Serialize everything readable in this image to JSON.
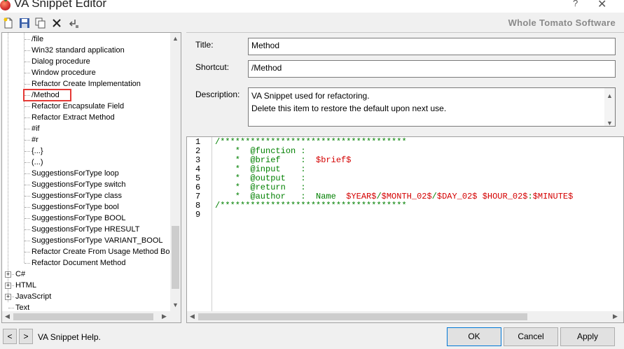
{
  "window": {
    "title": "VA Snippet Editor",
    "help_glyph": "?",
    "close_glyph": "✕"
  },
  "toolbar": {
    "brand": "Whole Tomato Software"
  },
  "tree": {
    "items": [
      {
        "label": "/file",
        "level": 2
      },
      {
        "label": "Win32 standard application",
        "level": 2
      },
      {
        "label": "Dialog procedure",
        "level": 2
      },
      {
        "label": "Window procedure",
        "level": 2
      },
      {
        "label": "Refactor Create Implementation",
        "level": 2
      },
      {
        "label": "/Method",
        "level": 2,
        "selected": true
      },
      {
        "label": "Refactor Encapsulate Field",
        "level": 2
      },
      {
        "label": "Refactor Extract Method",
        "level": 2
      },
      {
        "label": "#if",
        "level": 2
      },
      {
        "label": "#r",
        "level": 2
      },
      {
        "label": "{...}",
        "level": 2
      },
      {
        "label": "(...)",
        "level": 2
      },
      {
        "label": "SuggestionsForType loop",
        "level": 2
      },
      {
        "label": "SuggestionsForType switch",
        "level": 2
      },
      {
        "label": "SuggestionsForType class",
        "level": 2
      },
      {
        "label": "SuggestionsForType bool",
        "level": 2
      },
      {
        "label": "SuggestionsForType BOOL",
        "level": 2
      },
      {
        "label": "SuggestionsForType HRESULT",
        "level": 2
      },
      {
        "label": "SuggestionsForType VARIANT_BOOL",
        "level": 2
      },
      {
        "label": "Refactor Create From Usage Method Bod",
        "level": 2
      },
      {
        "label": "Refactor Document Method",
        "level": 2
      },
      {
        "label": "C#",
        "level": 1,
        "expander": "+"
      },
      {
        "label": "HTML",
        "level": 1,
        "expander": "+"
      },
      {
        "label": "JavaScript",
        "level": 1,
        "expander": "+"
      },
      {
        "label": "Text",
        "level": 1
      }
    ]
  },
  "form": {
    "title_label": "Title:",
    "title_value": "Method",
    "shortcut_label": "Shortcut:",
    "shortcut_value": "/Method",
    "description_label": "Description:",
    "description_line1": "VA Snippet used for refactoring.",
    "description_line2": "Delete this item to restore the default upon next use."
  },
  "editor": {
    "line_numbers": [
      "1",
      "2",
      "3",
      "4",
      "5",
      "6",
      "7",
      "8",
      "9"
    ],
    "lines": [
      [
        {
          "t": "/*************************************",
          "c": "green"
        }
      ],
      [
        {
          "t": "    *  @function :",
          "c": "green"
        }
      ],
      [
        {
          "t": "    *  @brief    :  ",
          "c": "green"
        },
        {
          "t": "$brief$",
          "c": "red"
        }
      ],
      [
        {
          "t": "    *  @input    :",
          "c": "green"
        }
      ],
      [
        {
          "t": "    *  @output   :",
          "c": "green"
        }
      ],
      [
        {
          "t": "    *  @return   :",
          "c": "green"
        }
      ],
      [
        {
          "t": "    *  @author   :  Name  ",
          "c": "green"
        },
        {
          "t": "$YEAR$",
          "c": "red"
        },
        {
          "t": "/",
          "c": "green"
        },
        {
          "t": "$MONTH_02$",
          "c": "red"
        },
        {
          "t": "/",
          "c": "green"
        },
        {
          "t": "$DAY_02$",
          "c": "red"
        },
        {
          "t": " ",
          "c": "green"
        },
        {
          "t": "$HOUR_02$",
          "c": "red"
        },
        {
          "t": ":",
          "c": "green"
        },
        {
          "t": "$MINUTE$",
          "c": "red"
        }
      ],
      [
        {
          "t": "/*************************************",
          "c": "green"
        }
      ],
      []
    ]
  },
  "bottom": {
    "prev_label": "<",
    "next_label": ">",
    "help_text": "VA Snippet Help.",
    "ok_label": "OK",
    "cancel_label": "Cancel",
    "apply_label": "Apply"
  },
  "colors": {
    "code_comment": "#008000",
    "code_variable": "#d40000",
    "selection_outline": "#e53935"
  }
}
